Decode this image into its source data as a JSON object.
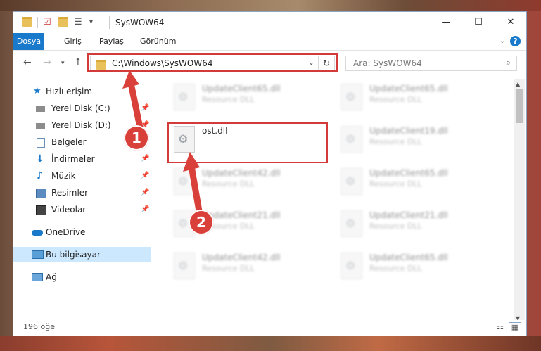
{
  "window": {
    "title": "SysWOW64",
    "controls": {
      "minimize": "—",
      "maximize": "☐",
      "close": "✕"
    }
  },
  "ribbon": {
    "tabs": [
      "Dosya",
      "Giriş",
      "Paylaş",
      "Görünüm"
    ],
    "help": "?"
  },
  "address": {
    "path": "C:\\Windows\\SysWOW64",
    "search_placeholder": "Ara: SysWOW64"
  },
  "sidebar": {
    "items": [
      {
        "label": "Hızlı erişim",
        "icon": "star-icon",
        "pinned": false
      },
      {
        "label": "Yerel Disk (C:)",
        "icon": "drive-icon",
        "pinned": true
      },
      {
        "label": "Yerel Disk (D:)",
        "icon": "drive-icon",
        "pinned": true
      },
      {
        "label": "Belgeler",
        "icon": "documents-icon",
        "pinned": true
      },
      {
        "label": "İndirmeler",
        "icon": "download-icon",
        "pinned": true
      },
      {
        "label": "Müzik",
        "icon": "music-icon",
        "pinned": true
      },
      {
        "label": "Resimler",
        "icon": "pictures-icon",
        "pinned": true
      },
      {
        "label": "Videolar",
        "icon": "video-icon",
        "pinned": true
      },
      {
        "label": "OneDrive",
        "icon": "cloud-icon",
        "pinned": false
      },
      {
        "label": "Bu bilgisayar",
        "icon": "computer-icon",
        "pinned": false
      },
      {
        "label": "Ağ",
        "icon": "network-icon",
        "pinned": false
      }
    ]
  },
  "files": [
    {
      "name": "UpdateClient65.dll",
      "type": "Resource DLL"
    },
    {
      "name": "UpdateClient65.dll",
      "type": "Resource DLL"
    },
    {
      "name": "ost.dll",
      "type": ""
    },
    {
      "name": "UpdateClient19.dll",
      "type": "Resource DLL"
    },
    {
      "name": "UpdateClient42.dll",
      "type": "Resource DLL"
    },
    {
      "name": "UpdateClient65.dll",
      "type": "Resource DLL"
    },
    {
      "name": "UpdateClient21.dll",
      "type": "Resource DLL"
    },
    {
      "name": "UpdateClient21.dll",
      "type": "Resource DLL"
    },
    {
      "name": "UpdateClient42.dll",
      "type": "Resource DLL"
    },
    {
      "name": "UpdateClient65.dll",
      "type": "Resource DLL"
    }
  ],
  "status": {
    "count": "196 öğe"
  },
  "annotations": {
    "badge1": "1",
    "badge2": "2",
    "color": "#d9403a"
  }
}
